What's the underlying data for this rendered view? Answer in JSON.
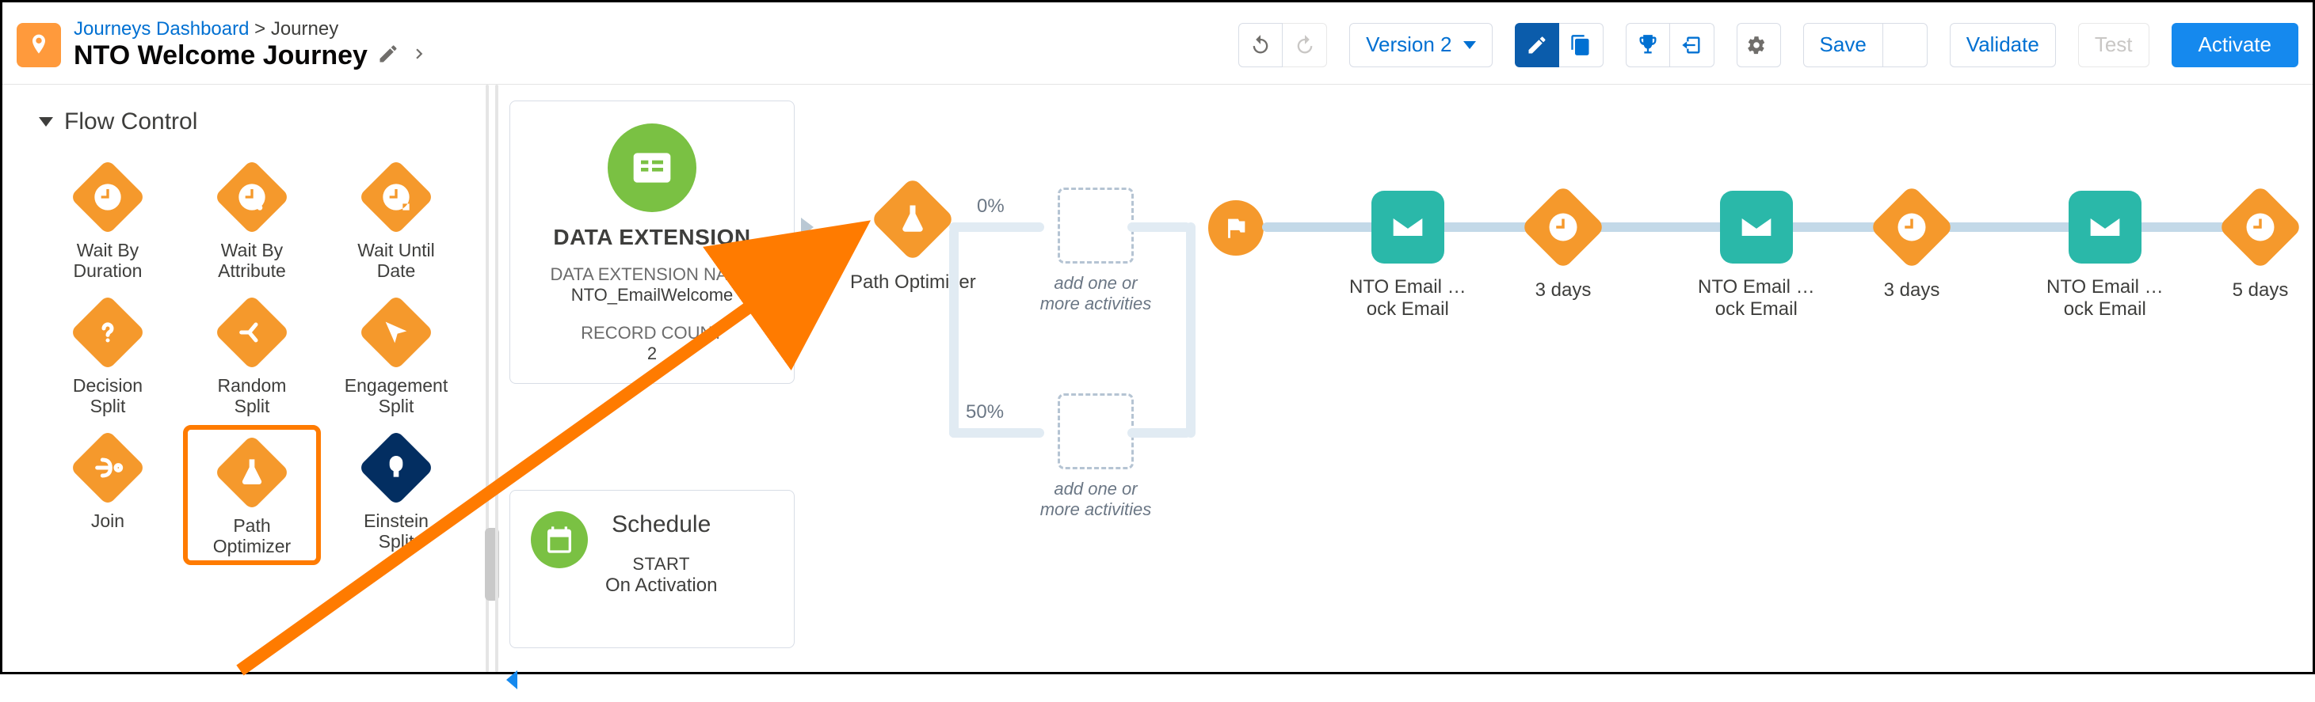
{
  "breadcrumb": {
    "dashboard": "Journeys Dashboard",
    "sep": ">",
    "here": "Journey"
  },
  "title": "NTO Welcome Journey",
  "header": {
    "version_label": "Version 2",
    "save_label": "Save",
    "validate_label": "Validate",
    "test_label": "Test",
    "activate_label": "Activate"
  },
  "sidebar": {
    "section_title": "Flow Control",
    "items": [
      {
        "label": "Wait By\nDuration"
      },
      {
        "label": "Wait By\nAttribute"
      },
      {
        "label": "Wait Until\nDate"
      },
      {
        "label": "Decision\nSplit"
      },
      {
        "label": "Random\nSplit"
      },
      {
        "label": "Engagement\nSplit"
      },
      {
        "label": "Join"
      },
      {
        "label": "Path\nOptimizer"
      },
      {
        "label": "Einstein\nSplit"
      }
    ]
  },
  "entry_card": {
    "title": "DATA EXTENSION",
    "sub1_label": "DATA EXTENSION NAME",
    "sub1_value": "NTO_EmailWelcome",
    "sub2_label": "RECORD COUNT",
    "sub2_value": "2"
  },
  "schedule_card": {
    "title": "Schedule",
    "line1": "START",
    "line2": "On Activation"
  },
  "canvas": {
    "path_optimizer_label": "Path Optimizer",
    "split_pct_top": "0%",
    "split_pct_bottom": "50%",
    "drop_hint": "add one or\nmore activities",
    "email1": "NTO Email …\nock Email",
    "wait1": "3 days",
    "email2": "NTO Email …\nock Email",
    "wait2": "3 days",
    "email3": "NTO Email …\nock Email",
    "wait3": "5 days"
  }
}
